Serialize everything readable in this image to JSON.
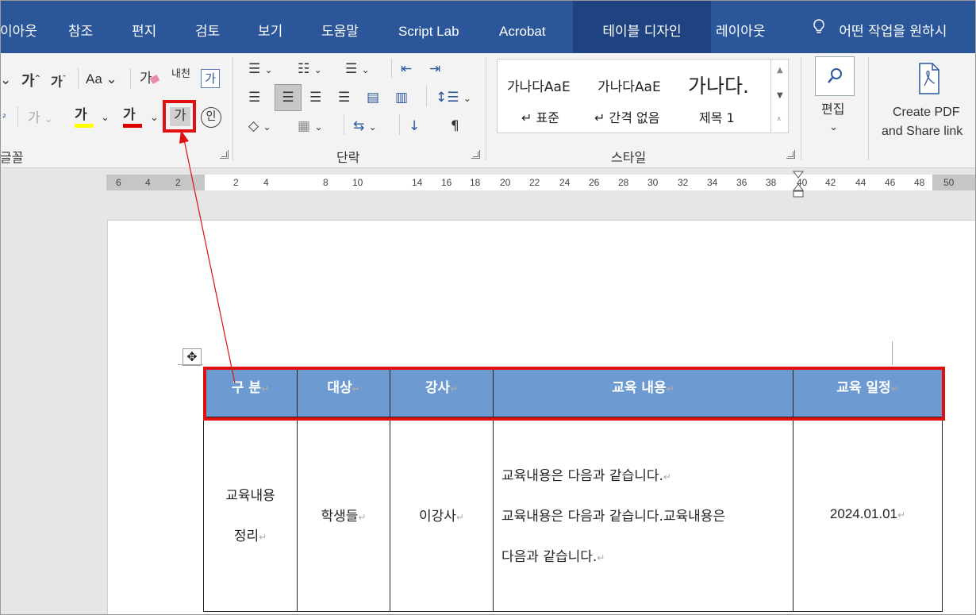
{
  "tabs": [
    "이아웃",
    "참조",
    "편지",
    "검토",
    "보기",
    "도움말",
    "Script Lab",
    "Acrobat",
    "테이블 디자인",
    "레이아웃",
    "어떤 작업을 원하시"
  ],
  "ribbon": {
    "font": {
      "grow": "가",
      "shrink": "가",
      "case": "Aa",
      "clear": "가",
      "phonetic": "내천",
      "charbox": "가",
      "highlight": "가",
      "fontcolor": "가",
      "shading": "가",
      "enclose": "인",
      "fade": "가",
      "group": "글꼴",
      "partial_label": "²"
    },
    "paragraph": {
      "group": "단락"
    },
    "styles": {
      "items": [
        "가나다AaE",
        "가나다AaE",
        "가나다."
      ],
      "names": [
        "표준",
        "간격 없음",
        "제목 1"
      ],
      "group": "스타일"
    },
    "editing": {
      "label": "편집"
    },
    "acrobat": {
      "label1": "Create PDF",
      "label2": "and Share link"
    }
  },
  "ruler": {
    "numbers": [
      "6",
      "4",
      "2",
      "2",
      "4",
      "8",
      "10",
      "14",
      "16",
      "18",
      "20",
      "22",
      "24",
      "26",
      "28",
      "30",
      "32",
      "34",
      "36",
      "38",
      "40",
      "42",
      "44",
      "46",
      "48",
      "50"
    ]
  },
  "table": {
    "headers": [
      "구 분",
      "대상",
      "강사",
      "교육 내용",
      "교육 일정"
    ],
    "row": {
      "c1a": "교육내용",
      "c1b": "정리",
      "c2": "학생들",
      "c3": "이강사",
      "c4a": "교육내용은 다음과 같습니다.",
      "c4b": "교육내용은 다음과 같습니다.교육내용은",
      "c4c": "다음과 같습니다.",
      "c5": "2024.01.01"
    }
  },
  "colors": {
    "tabbar": "#2b579a",
    "header_fill": "#6d9bd1",
    "highlight_red": "#e01010"
  }
}
